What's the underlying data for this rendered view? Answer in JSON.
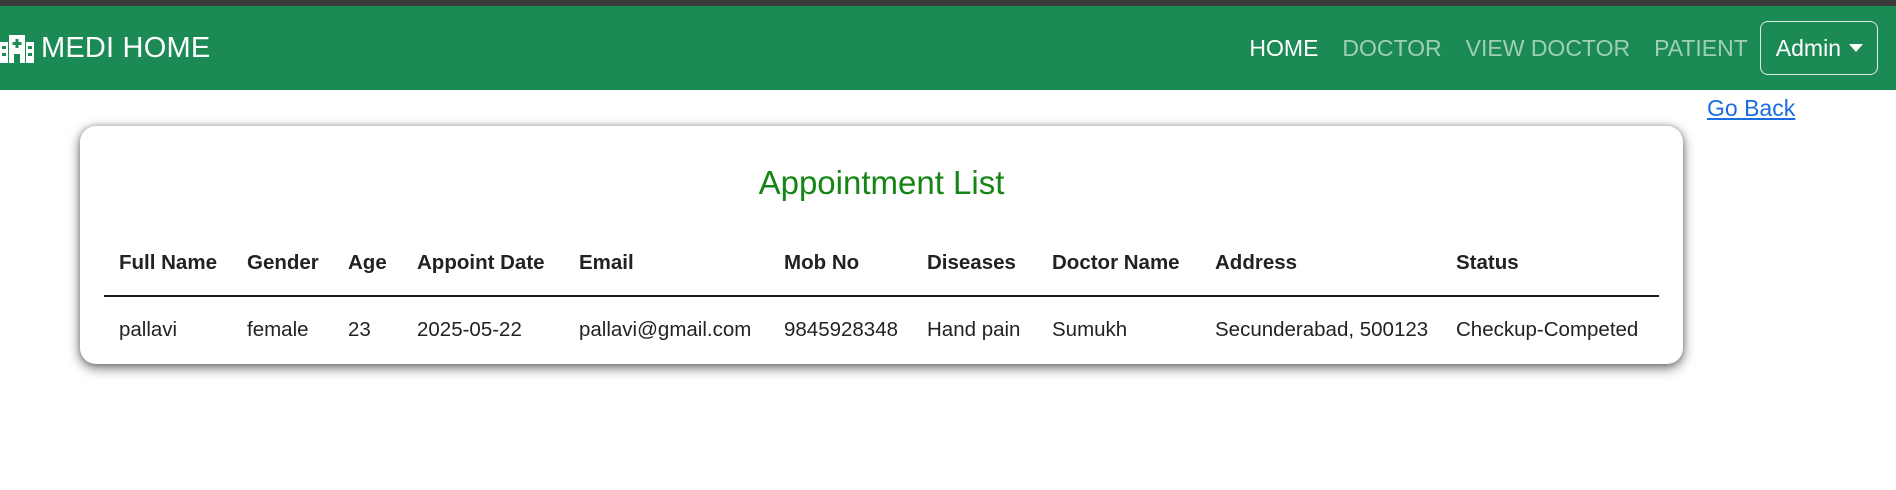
{
  "navbar": {
    "brand": "MEDI HOME",
    "brand_icon": "hospital-icon",
    "links": [
      "HOME",
      "DOCTOR",
      "VIEW DOCTOR",
      "PATIENT"
    ],
    "active_link": "HOME",
    "admin_label": "Admin",
    "bg_color": "#1b8a55"
  },
  "page": {
    "go_back": "Go Back",
    "title": "Appointment List",
    "title_color": "#158515"
  },
  "table": {
    "headers": [
      "Full Name",
      "Gender",
      "Age",
      "Appoint Date",
      "Email",
      "Mob No",
      "Diseases",
      "Doctor Name",
      "Address",
      "Status"
    ],
    "rows": [
      [
        "pallavi",
        "female",
        "23",
        "2025-05-22",
        "pallavi@gmail.com",
        "9845928348",
        "Hand pain",
        "Sumukh",
        "Secunderabad, 500123",
        "Checkup-Competed"
      ]
    ]
  }
}
